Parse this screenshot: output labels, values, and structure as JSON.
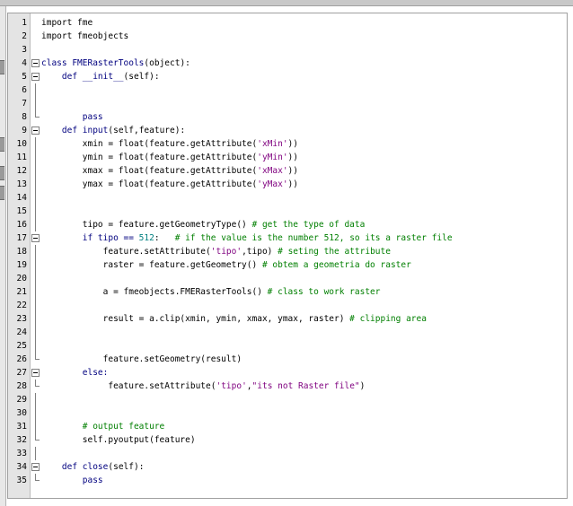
{
  "editor": {
    "lines": [
      {
        "n": "1",
        "fold": "none",
        "tokens": [
          {
            "t": "import fme",
            "c": ""
          }
        ]
      },
      {
        "n": "2",
        "fold": "none",
        "tokens": [
          {
            "t": "import fmeobjects",
            "c": ""
          }
        ]
      },
      {
        "n": "3",
        "fold": "none",
        "tokens": []
      },
      {
        "n": "4",
        "fold": "open",
        "tokens": [
          {
            "t": "class ",
            "c": "kw"
          },
          {
            "t": "FMERasterTools",
            "c": "fn"
          },
          {
            "t": "(object):",
            "c": ""
          }
        ]
      },
      {
        "n": "5",
        "fold": "open",
        "tokens": [
          {
            "t": "    def ",
            "c": "kw"
          },
          {
            "t": "__init__",
            "c": "fn"
          },
          {
            "t": "(self):",
            "c": ""
          }
        ]
      },
      {
        "n": "6",
        "fold": "line",
        "tokens": []
      },
      {
        "n": "7",
        "fold": "line",
        "tokens": []
      },
      {
        "n": "8",
        "fold": "end",
        "tokens": [
          {
            "t": "        pass",
            "c": "kw"
          }
        ]
      },
      {
        "n": "9",
        "fold": "open",
        "tokens": [
          {
            "t": "    def ",
            "c": "kw"
          },
          {
            "t": "input",
            "c": "fn"
          },
          {
            "t": "(self,feature):",
            "c": ""
          }
        ]
      },
      {
        "n": "10",
        "fold": "line",
        "tokens": [
          {
            "t": "        xmin = float(feature.getAttribute(",
            "c": ""
          },
          {
            "t": "'xMin'",
            "c": "str"
          },
          {
            "t": "))",
            "c": ""
          }
        ]
      },
      {
        "n": "11",
        "fold": "line",
        "tokens": [
          {
            "t": "        ymin = float(feature.getAttribute(",
            "c": ""
          },
          {
            "t": "'yMin'",
            "c": "str"
          },
          {
            "t": "))",
            "c": ""
          }
        ]
      },
      {
        "n": "12",
        "fold": "line",
        "tokens": [
          {
            "t": "        xmax = float(feature.getAttribute(",
            "c": ""
          },
          {
            "t": "'xMax'",
            "c": "str"
          },
          {
            "t": "))",
            "c": ""
          }
        ]
      },
      {
        "n": "13",
        "fold": "line",
        "tokens": [
          {
            "t": "        ymax = float(feature.getAttribute(",
            "c": ""
          },
          {
            "t": "'yMax'",
            "c": "str"
          },
          {
            "t": "))",
            "c": ""
          }
        ]
      },
      {
        "n": "14",
        "fold": "line",
        "tokens": []
      },
      {
        "n": "15",
        "fold": "line",
        "tokens": []
      },
      {
        "n": "16",
        "fold": "line",
        "tokens": [
          {
            "t": "        tipo = feature.getGeometryType() ",
            "c": ""
          },
          {
            "t": "# get the type of data",
            "c": "cmt"
          }
        ]
      },
      {
        "n": "17",
        "fold": "open",
        "tokens": [
          {
            "t": "        if tipo == ",
            "c": "kw"
          },
          {
            "t": "512",
            "c": "num"
          },
          {
            "t": ":   ",
            "c": ""
          },
          {
            "t": "# if the value is the number 512, so its a raster file",
            "c": "cmt"
          }
        ]
      },
      {
        "n": "18",
        "fold": "line",
        "tokens": [
          {
            "t": "            feature.setAttribute(",
            "c": ""
          },
          {
            "t": "'tipo'",
            "c": "str"
          },
          {
            "t": ",tipo) ",
            "c": ""
          },
          {
            "t": "# seting the attribute",
            "c": "cmt"
          }
        ]
      },
      {
        "n": "19",
        "fold": "line",
        "tokens": [
          {
            "t": "            raster = feature.getGeometry() ",
            "c": ""
          },
          {
            "t": "# obtem a geometria do raster",
            "c": "cmt"
          }
        ]
      },
      {
        "n": "20",
        "fold": "line",
        "tokens": []
      },
      {
        "n": "21",
        "fold": "line",
        "tokens": [
          {
            "t": "            a = fmeobjects.FMERasterTools() ",
            "c": ""
          },
          {
            "t": "# class to work raster",
            "c": "cmt"
          }
        ]
      },
      {
        "n": "22",
        "fold": "line",
        "tokens": []
      },
      {
        "n": "23",
        "fold": "line",
        "tokens": [
          {
            "t": "            result = a.clip(xmin, ymin, xmax, ymax, raster) ",
            "c": ""
          },
          {
            "t": "# clipping area",
            "c": "cmt"
          }
        ]
      },
      {
        "n": "24",
        "fold": "line",
        "tokens": []
      },
      {
        "n": "25",
        "fold": "line",
        "tokens": []
      },
      {
        "n": "26",
        "fold": "end",
        "tokens": [
          {
            "t": "            feature.setGeometry(result)",
            "c": ""
          }
        ]
      },
      {
        "n": "27",
        "fold": "open",
        "tokens": [
          {
            "t": "        else:",
            "c": "kw"
          }
        ]
      },
      {
        "n": "28",
        "fold": "end",
        "tokens": [
          {
            "t": "             feature.setAttribute(",
            "c": ""
          },
          {
            "t": "'tipo'",
            "c": "str"
          },
          {
            "t": ",",
            "c": ""
          },
          {
            "t": "\"its not Raster file\"",
            "c": "str"
          },
          {
            "t": ")",
            "c": ""
          }
        ]
      },
      {
        "n": "29",
        "fold": "line",
        "tokens": []
      },
      {
        "n": "30",
        "fold": "line",
        "tokens": []
      },
      {
        "n": "31",
        "fold": "line",
        "tokens": [
          {
            "t": "        # output feature",
            "c": "cmt"
          }
        ]
      },
      {
        "n": "32",
        "fold": "end",
        "tokens": [
          {
            "t": "        self.pyoutput(feature)",
            "c": ""
          }
        ]
      },
      {
        "n": "33",
        "fold": "line",
        "tokens": []
      },
      {
        "n": "34",
        "fold": "open",
        "tokens": [
          {
            "t": "    def ",
            "c": "kw"
          },
          {
            "t": "close",
            "c": "fn"
          },
          {
            "t": "(self):",
            "c": ""
          }
        ]
      },
      {
        "n": "35",
        "fold": "end",
        "tokens": [
          {
            "t": "        pass",
            "c": "kw"
          }
        ]
      }
    ]
  },
  "colors": {
    "keyword": "#00007f",
    "string": "#7f007f",
    "number": "#007f7f",
    "comment": "#007f00",
    "gutter": "#e4e4e4"
  }
}
